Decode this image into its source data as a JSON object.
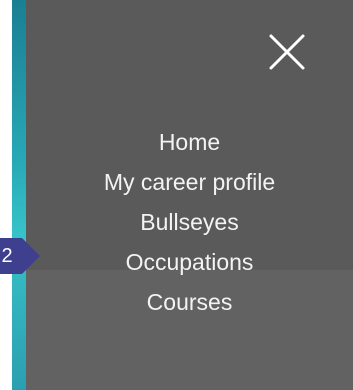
{
  "menu": {
    "close_icon": "close-icon",
    "items": [
      {
        "label": "Home"
      },
      {
        "label": "My career profile"
      },
      {
        "label": "Bullseyes"
      },
      {
        "label": "Occupations"
      },
      {
        "label": "Courses"
      }
    ]
  },
  "badge": {
    "text": "2",
    "color": "#3f3f8f"
  },
  "colors": {
    "panel": "#5a5a5a",
    "teal_edge": "#2aa8b6",
    "menu_text": "#f3f3f3"
  }
}
